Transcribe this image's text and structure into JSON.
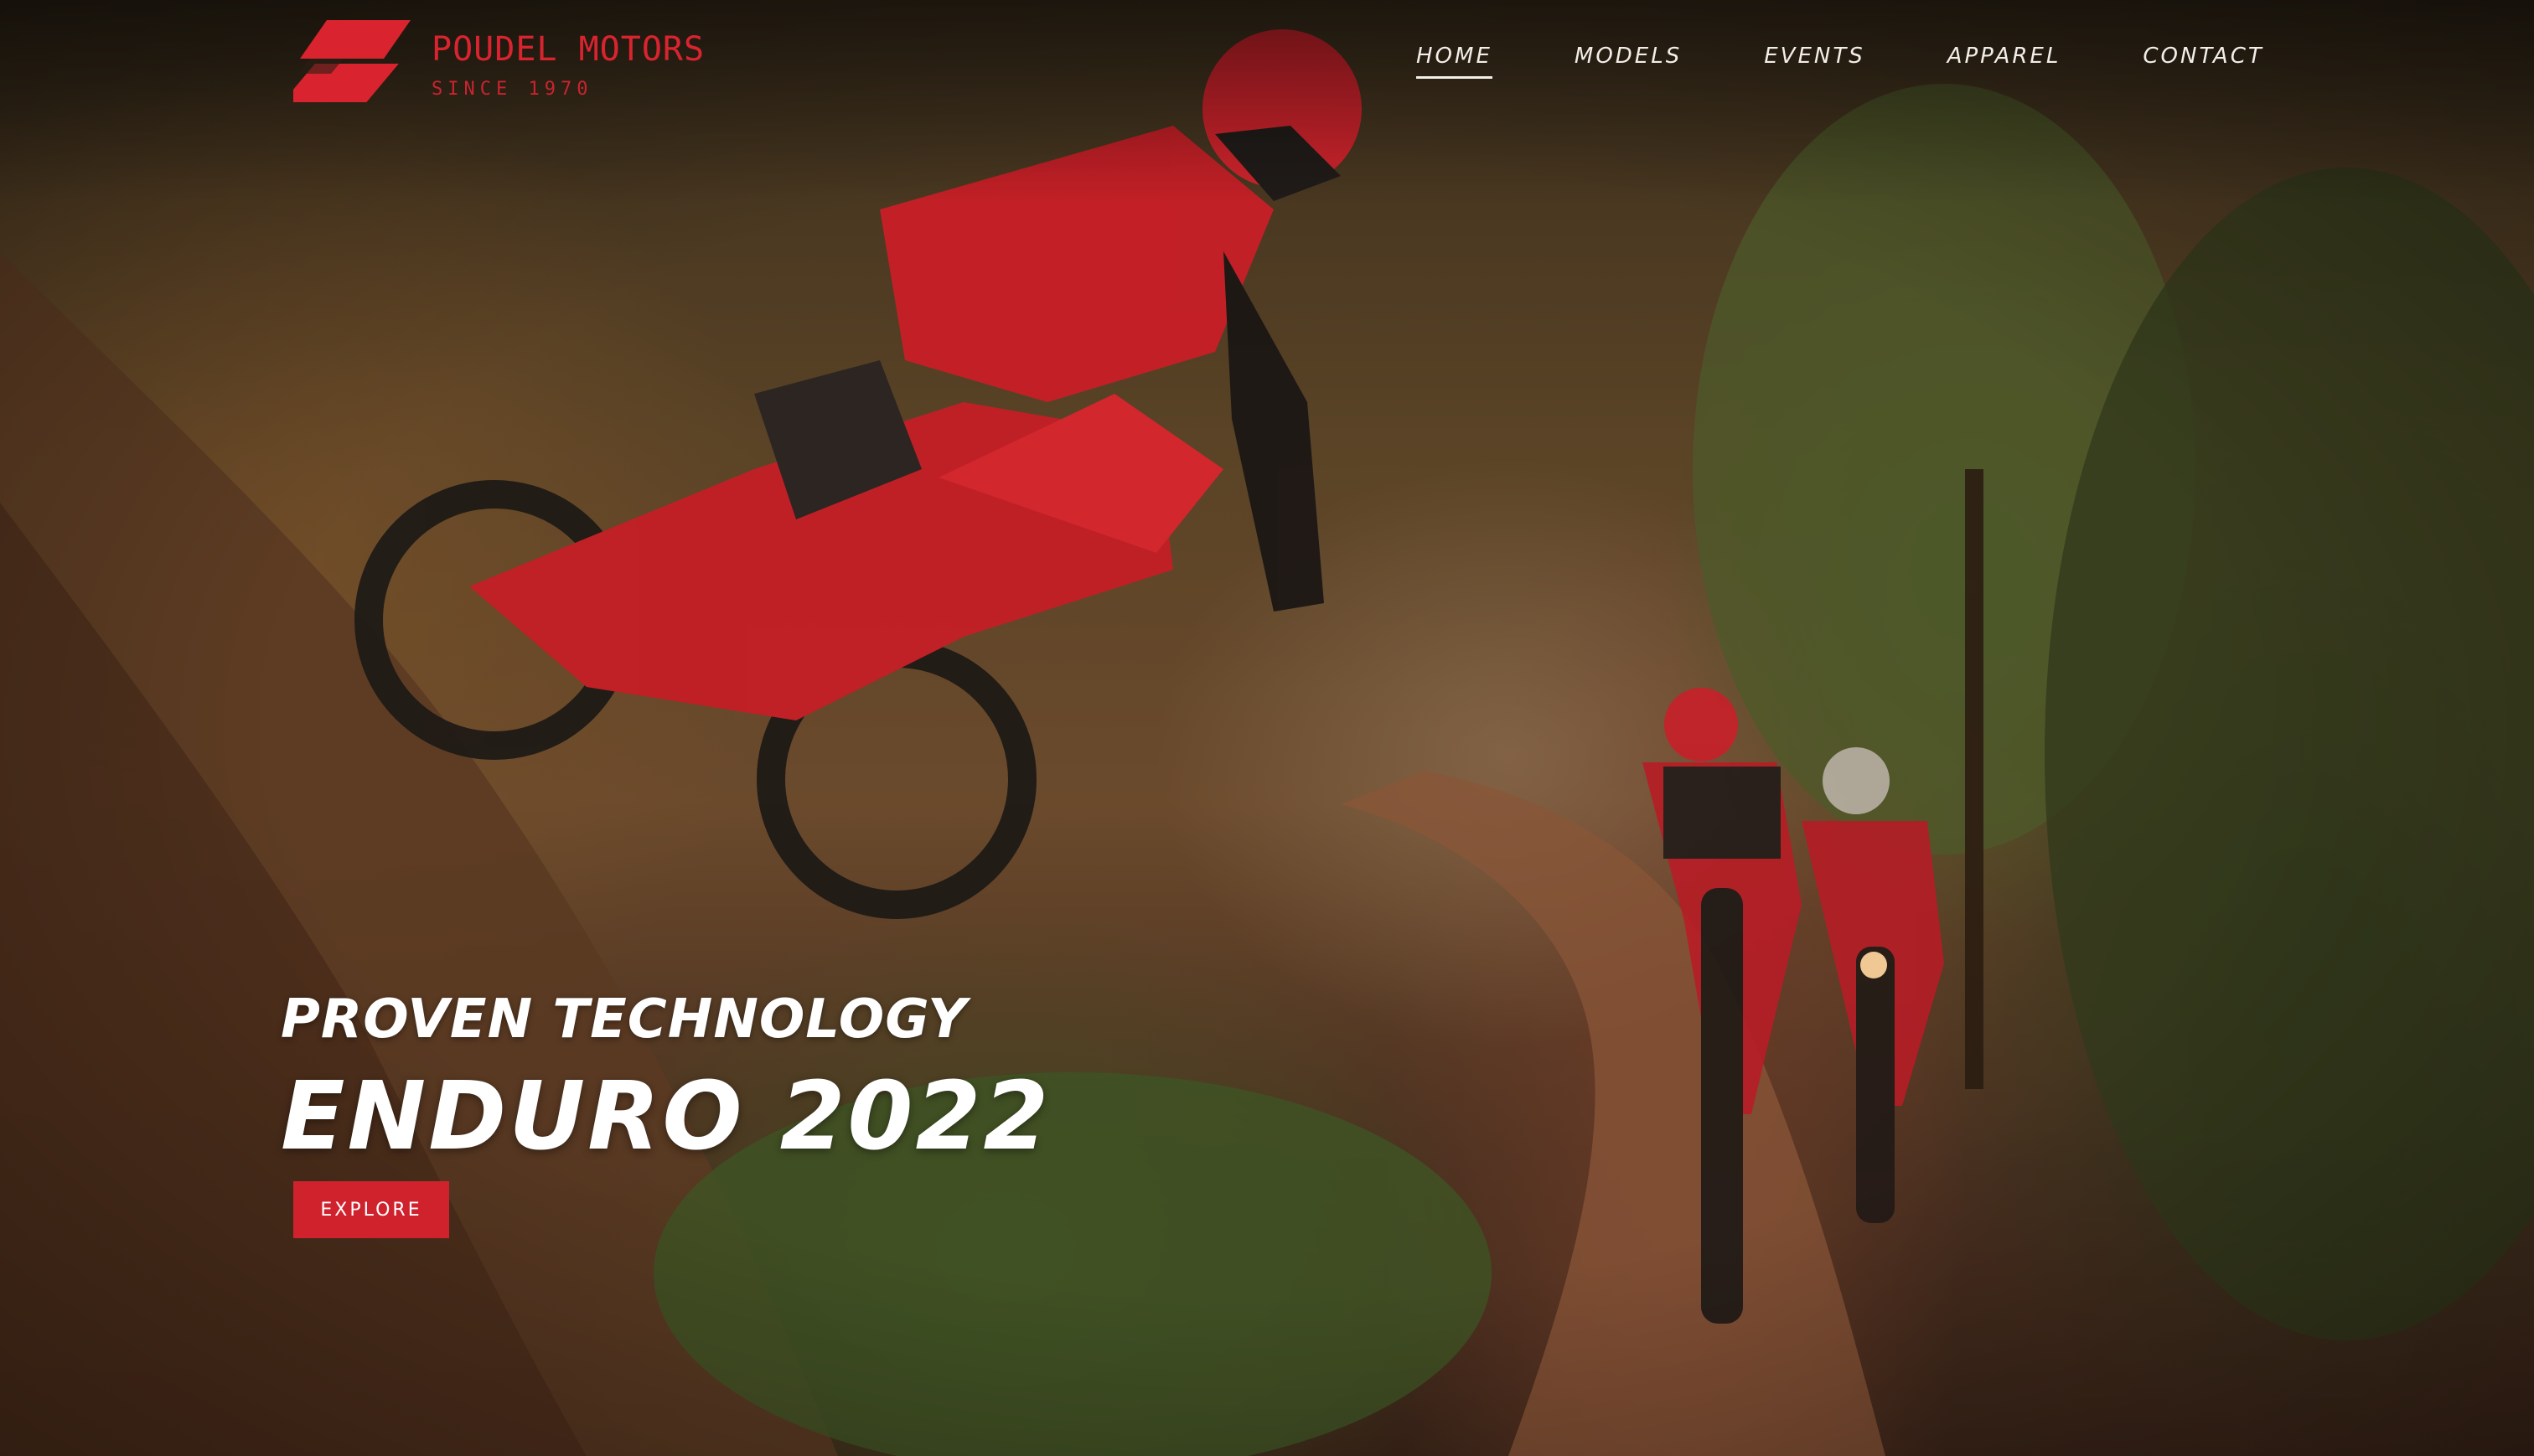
{
  "brand": {
    "name": "POUDEL MOTORS",
    "tagline": "SINCE 1970",
    "accent_color": "#d0222d"
  },
  "nav": {
    "items": [
      {
        "label": "HOME",
        "active": true
      },
      {
        "label": "MODELS",
        "active": false
      },
      {
        "label": "EVENTS",
        "active": false
      },
      {
        "label": "APPAREL",
        "active": false
      },
      {
        "label": "CONTACT",
        "active": false
      }
    ]
  },
  "hero": {
    "kicker": "PROVEN TECHNOLOGY",
    "headline": "ENDURO 2022",
    "cta_label": "EXPLORE"
  }
}
